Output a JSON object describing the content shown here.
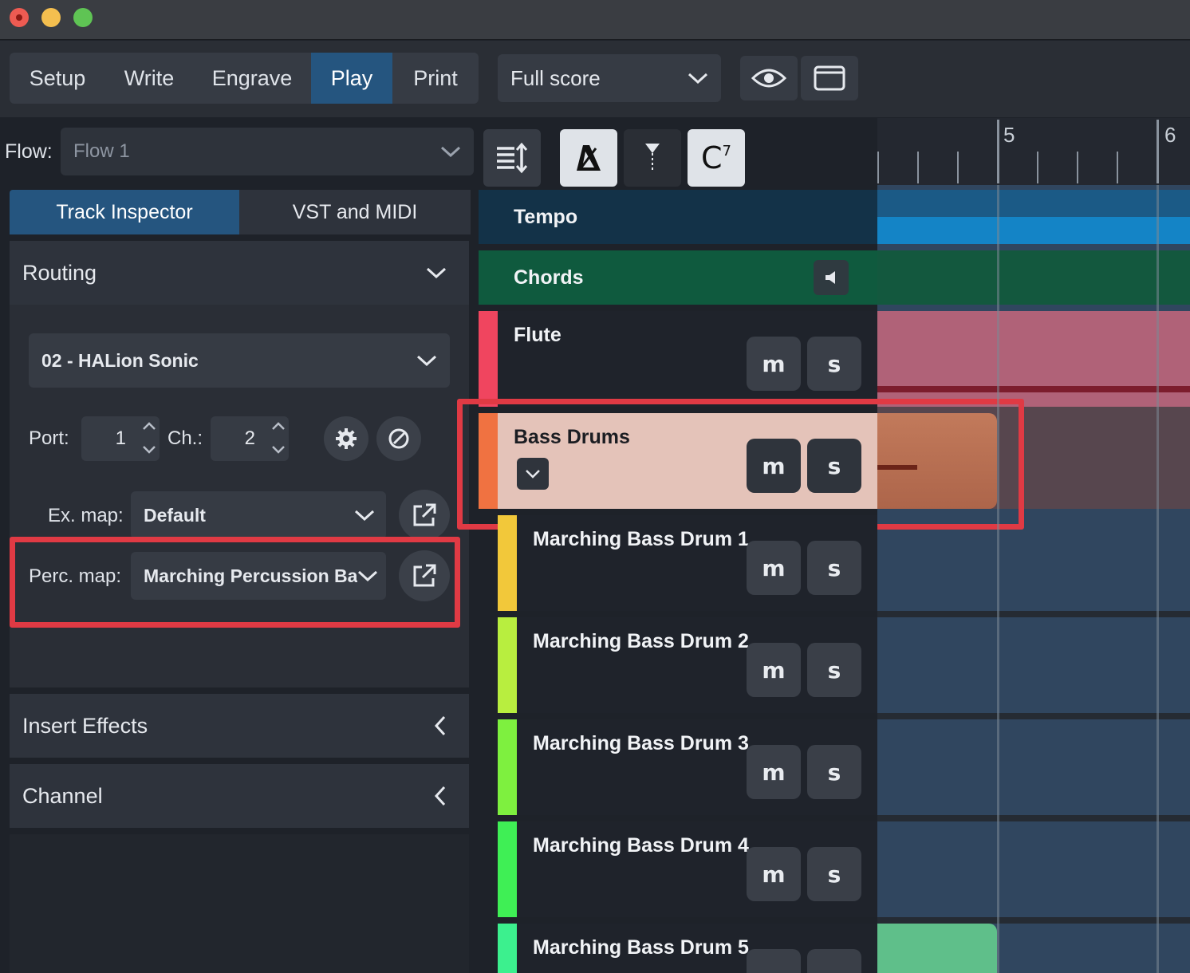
{
  "modes": [
    {
      "label": "Setup",
      "active": false
    },
    {
      "label": "Write",
      "active": false
    },
    {
      "label": "Engrave",
      "active": false
    },
    {
      "label": "Play",
      "active": true
    },
    {
      "label": "Print",
      "active": false
    }
  ],
  "layout_select": {
    "value": "Full score",
    "icon": "chevron-down-icon"
  },
  "view_buttons": [
    "eye-icon",
    "window-icon"
  ],
  "flow": {
    "label": "Flow:",
    "value": "Flow 1"
  },
  "inspector_tabs": [
    {
      "label": "Track Inspector",
      "active": true
    },
    {
      "label": "VST and MIDI",
      "active": false
    }
  ],
  "routing": {
    "title": "Routing",
    "instrument": "02 - HALion Sonic",
    "port_label": "Port:",
    "port_value": "1",
    "ch_label": "Ch.:",
    "ch_value": "2",
    "ex_map_label": "Ex. map:",
    "ex_map_value": "Default",
    "perc_map_label": "Perc. map:",
    "perc_map_value": "Marching Percussion Ba…"
  },
  "sections": [
    {
      "title": "Insert Effects"
    },
    {
      "title": "Channel"
    }
  ],
  "track_tools": {
    "chord_symbol": "C",
    "chord_sup": "7"
  },
  "ruler": {
    "bar_labels": [
      "5",
      "6"
    ]
  },
  "tracks": {
    "tempo": "Tempo",
    "chords": "Chords",
    "flute": "Flute",
    "bass_drums": "Bass Drums",
    "mute": "m",
    "solo": "s",
    "drums": [
      {
        "name": "Marching Bass Drum 1",
        "color": "#f2c83a"
      },
      {
        "name": "Marching Bass Drum 2",
        "color": "#b8ee3f"
      },
      {
        "name": "Marching Bass Drum 3",
        "color": "#7ef03f"
      },
      {
        "name": "Marching Bass Drum 4",
        "color": "#3fef55"
      },
      {
        "name": "Marching Bass Drum 5",
        "color": "#3cf08e"
      }
    ]
  },
  "colors": {
    "accent": "#25557f",
    "highlight": "#e03a44",
    "flute": "#f0455f",
    "bass_drums": "#f07241",
    "tempo": "#1484c6",
    "chords": "#0f5a3e"
  }
}
